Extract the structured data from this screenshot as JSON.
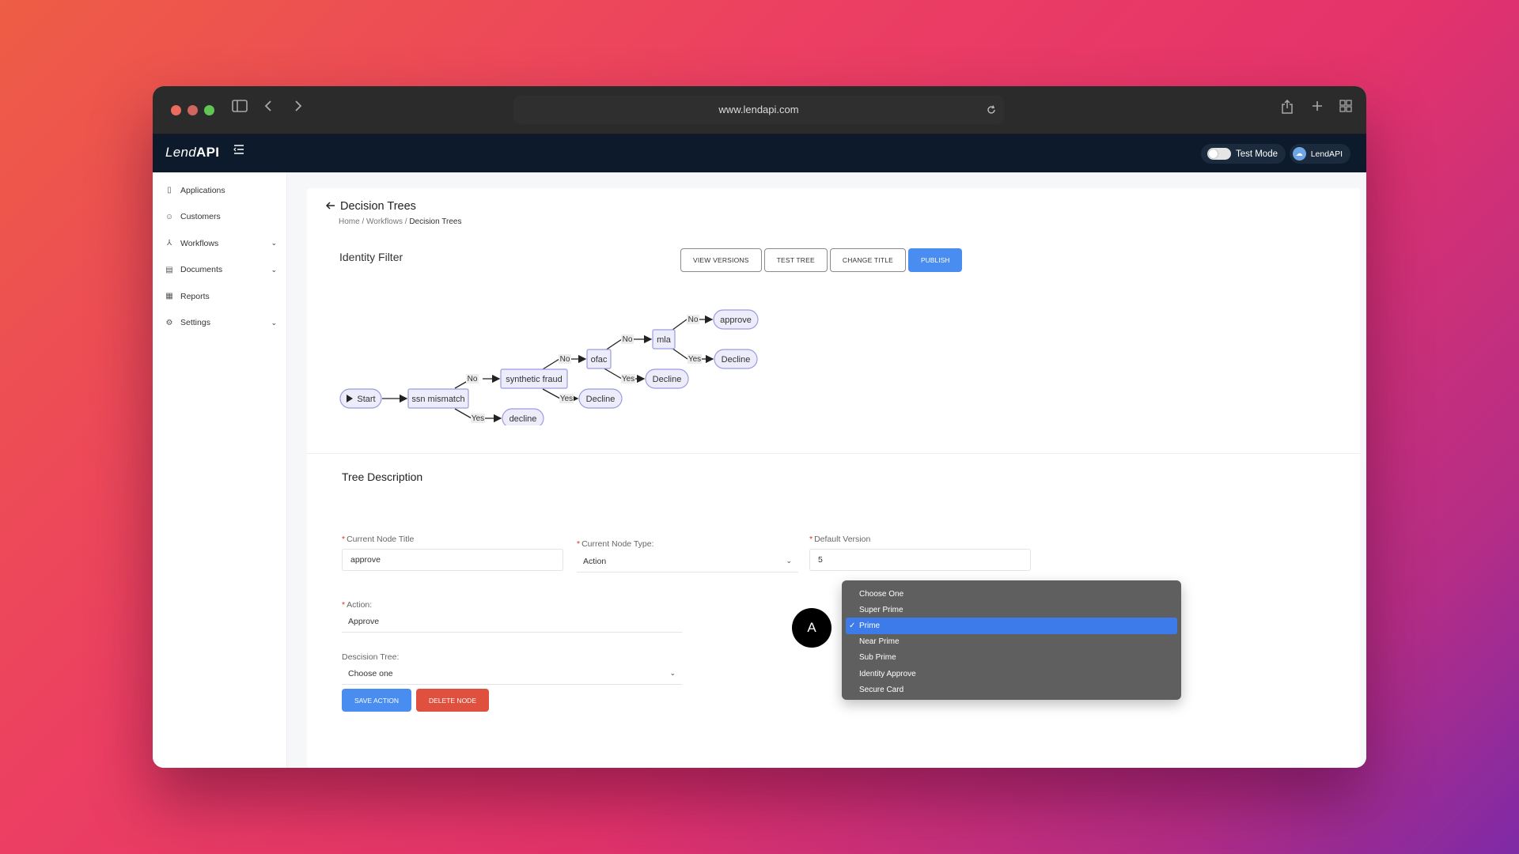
{
  "browser": {
    "url": "www.lendapi.com"
  },
  "app": {
    "logo_italic": "Lend",
    "logo_bold": "API",
    "test_mode_label": "Test Mode",
    "user_label": "LendAPI"
  },
  "sidebar": {
    "items": [
      {
        "label": "Applications",
        "icon": "document-icon"
      },
      {
        "label": "Customers",
        "icon": "users-icon"
      },
      {
        "label": "Workflows",
        "icon": "workflow-icon"
      },
      {
        "label": "Documents",
        "icon": "file-icon"
      },
      {
        "label": "Reports",
        "icon": "chart-icon"
      },
      {
        "label": "Settings",
        "icon": "gear-icon"
      }
    ]
  },
  "page": {
    "title": "Decision Trees",
    "breadcrumb": {
      "home": "Home",
      "workflows": "Workflows",
      "current": "Decision Trees",
      "sep": "/"
    },
    "tree_name": "Identity Filter",
    "buttons": {
      "view_versions": "VIEW VERSIONS",
      "test_tree": "TEST TREE",
      "change_title": "CHANGE TITLE",
      "publish": "PUBLISH"
    }
  },
  "diagram": {
    "nodes": {
      "start": "Start",
      "ssn": "ssn mismatch",
      "synthetic": "synthetic fraud",
      "ofac": "ofac",
      "mla": "mla",
      "approve": "approve",
      "decline_mla": "Decline",
      "decline_ofac": "Decline",
      "decline_synth": "Decline",
      "decline_ssn": "decline"
    },
    "edge_labels": {
      "no": "No",
      "yes": "Yes"
    }
  },
  "form": {
    "section_title": "Tree Description",
    "current_node_title_label": "Current Node Title",
    "current_node_title_value": "approve",
    "current_node_type_label": "Current Node Type:",
    "current_node_type_value": "Action",
    "default_version_label": "Default Version",
    "default_version_value": "5",
    "action_label": "Action:",
    "action_value": "Approve",
    "decision_tree_label": "Descision Tree:",
    "decision_tree_value": "Choose one",
    "save_label": "SAVE ACTION",
    "delete_label": "DELETE NODE"
  },
  "dropdown": {
    "options": [
      "Choose One",
      "Super Prime",
      "Prime",
      "Near Prime",
      "Sub Prime",
      "Identity Approve",
      "Secure Card"
    ],
    "selected": "Prime",
    "check": "✓"
  },
  "overlay_badge": "A",
  "colors": {
    "accent": "#4a8df0",
    "danger": "#e0503f",
    "header": "#0c1a2c",
    "node_fill": "#ececfb",
    "node_stroke": "#9b9be0"
  }
}
